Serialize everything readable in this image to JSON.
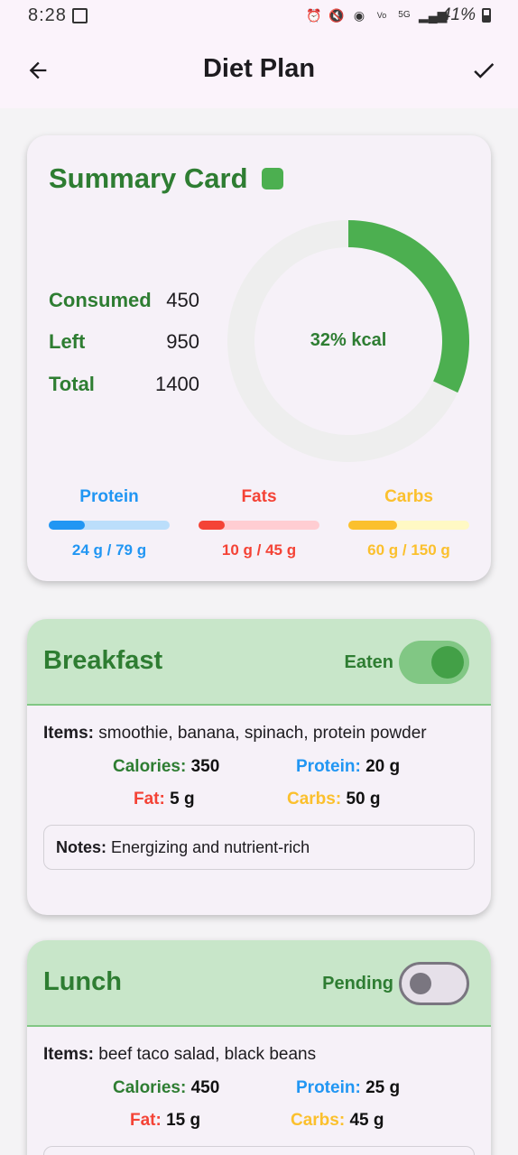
{
  "status_bar": {
    "time": "8:28",
    "battery": "41%"
  },
  "app_bar": {
    "title": "Diet Plan"
  },
  "summary": {
    "title": "Summary Card",
    "consumed_label": "Consumed",
    "consumed_value": "450",
    "left_label": "Left",
    "left_value": "950",
    "total_label": "Total",
    "total_value": "1400",
    "progress_text": "32% kcal",
    "progress_fraction": 0.32,
    "colors": {
      "accent": "#4caf50",
      "title": "#2e7d32",
      "ring_track": "#eeeeee"
    }
  },
  "macros": [
    {
      "name": "Protein",
      "amount": "24 g / 79 g",
      "fraction": 0.3,
      "color": "#2196f3",
      "track": "#bbdefb"
    },
    {
      "name": "Fats",
      "amount": "10 g / 45 g",
      "fraction": 0.22,
      "color": "#f44336",
      "track": "#ffcdd2"
    },
    {
      "name": "Carbs",
      "amount": "60 g / 150 g",
      "fraction": 0.4,
      "color": "#fbc02d",
      "track": "#fff9c4"
    }
  ],
  "meals": [
    {
      "name": "Breakfast",
      "status": "Eaten",
      "toggle_on": true,
      "items_label": "Items:",
      "items": "smoothie, banana, spinach, protein powder",
      "calories_label": "Calories:",
      "calories": "350",
      "protein_label": "Protein:",
      "protein": "20 g",
      "fat_label": "Fat:",
      "fat": "5 g",
      "carbs_label": "Carbs:",
      "carbs": "50 g",
      "notes_label": "Notes:",
      "notes": "Energizing and nutrient-rich"
    },
    {
      "name": "Lunch",
      "status": "Pending",
      "toggle_on": false,
      "items_label": "Items:",
      "items": "beef taco salad, black beans",
      "calories_label": "Calories:",
      "calories": "450",
      "protein_label": "Protein:",
      "protein": "25 g",
      "fat_label": "Fat:",
      "fat": "15 g",
      "carbs_label": "Carbs:",
      "carbs": "45 g"
    }
  ]
}
